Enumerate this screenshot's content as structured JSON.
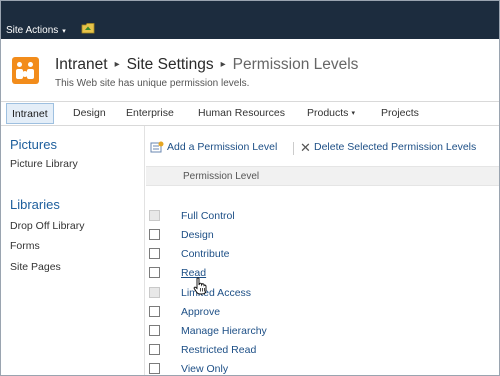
{
  "ribbon": {
    "site_actions_label": "Site Actions",
    "caret": "▾"
  },
  "header": {
    "breadcrumb": [
      "Intranet",
      "Site Settings",
      "Permission Levels"
    ],
    "separator": "▸",
    "subtitle": "This Web site has unique permission levels."
  },
  "topnav": {
    "items": [
      {
        "label": "Intranet",
        "active": true
      },
      {
        "label": "Design"
      },
      {
        "label": "Enterprise"
      },
      {
        "label": "Human Resources"
      },
      {
        "label": "Products",
        "has_menu": true
      },
      {
        "label": "Projects"
      }
    ],
    "caret": "▾"
  },
  "leftnav": {
    "sections": [
      {
        "heading": "Pictures",
        "items": [
          "Picture Library"
        ]
      },
      {
        "heading": "Libraries",
        "items": [
          "Drop Off Library",
          "Forms",
          "Site Pages"
        ]
      }
    ]
  },
  "toolbar": {
    "add_label": "Add a Permission Level",
    "delete_label": "Delete Selected Permission Levels",
    "delete_glyph": "✕"
  },
  "list": {
    "column_header": "Permission Level",
    "rows": [
      {
        "label": "Full Control",
        "disabled": true
      },
      {
        "label": "Design",
        "disabled": false
      },
      {
        "label": "Contribute",
        "disabled": false
      },
      {
        "label": "Read",
        "disabled": false,
        "hover": true
      },
      {
        "label": "Limited Access",
        "disabled": true
      },
      {
        "label": "Approve",
        "disabled": false
      },
      {
        "label": "Manage Hierarchy",
        "disabled": false
      },
      {
        "label": "Restricted Read",
        "disabled": false
      },
      {
        "label": "View Only",
        "disabled": false
      }
    ]
  },
  "colors": {
    "ribbon_bg": "#1c2c3e",
    "link_blue": "#1d4f86",
    "heading_blue": "#1d5e9c",
    "logo_orange": "#f28c1b"
  }
}
